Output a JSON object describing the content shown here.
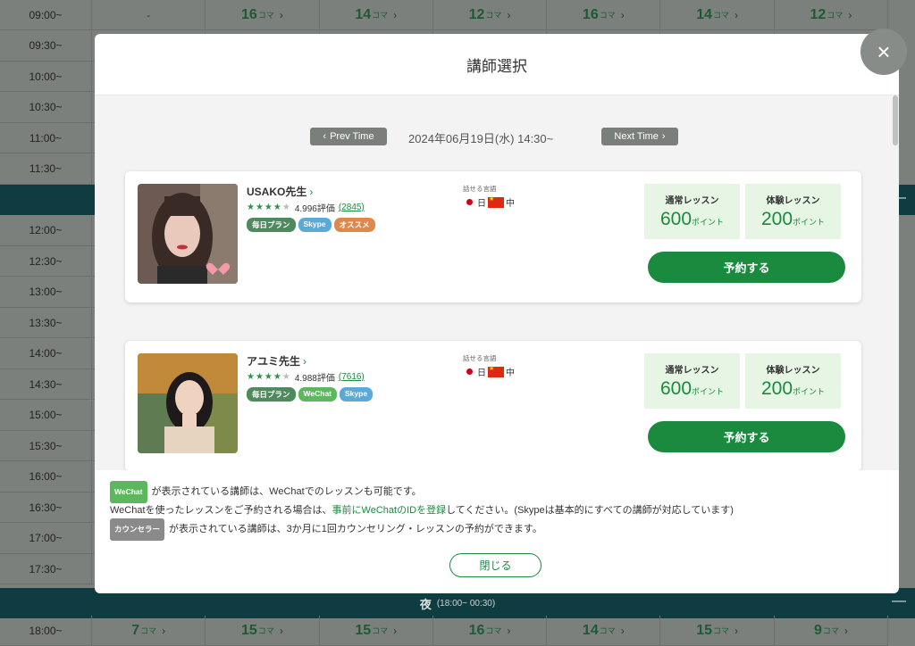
{
  "schedule": {
    "rows": [
      {
        "time": "09:00~",
        "slots": [
          {
            "count": "-"
          },
          {
            "count": "16"
          },
          {
            "count": "14"
          },
          {
            "count": "12"
          },
          {
            "count": "16"
          },
          {
            "count": "14"
          },
          {
            "count": "12"
          }
        ]
      },
      {
        "time": "09:30~"
      },
      {
        "time": "10:00~"
      },
      {
        "time": "10:30~"
      },
      {
        "time": "11:00~"
      },
      {
        "time": "11:30~"
      },
      {
        "band": true
      },
      {
        "time": "12:00~"
      },
      {
        "time": "12:30~"
      },
      {
        "time": "13:00~"
      },
      {
        "time": "13:30~"
      },
      {
        "time": "14:00~"
      },
      {
        "time": "14:30~"
      },
      {
        "time": "15:00~"
      },
      {
        "time": "15:30~"
      },
      {
        "time": "16:00~"
      },
      {
        "time": "16:30~"
      },
      {
        "time": "17:00~"
      },
      {
        "time": "17:30~"
      }
    ],
    "unit": "コマ",
    "band_toggle": "—",
    "evening_band": {
      "title": "夜",
      "sub": "(18:00~ 00:30)",
      "toggle": "—"
    },
    "evening_row": {
      "time": "18:00~",
      "slots": [
        {
          "count": "7"
        },
        {
          "count": "15"
        },
        {
          "count": "15"
        },
        {
          "count": "16"
        },
        {
          "count": "14"
        },
        {
          "count": "15"
        },
        {
          "count": "9"
        }
      ]
    }
  },
  "modal": {
    "title": "講師選択",
    "close_icon": "×",
    "nav": {
      "prev": "Prev Time",
      "next": "Next Time",
      "current": "2024年06月19日(水) 14:30~"
    },
    "lang_label": "話せる言語",
    "lang_jp": "日",
    "lang_cn": "中",
    "teachers": [
      {
        "name": "USAKO先生",
        "rating": "4.996評価",
        "reviews": "(2845)",
        "stars_on": 4,
        "tags": [
          {
            "label": "毎日プラン",
            "color": "#4e8a5d"
          },
          {
            "label": "Skype",
            "color": "#5aa9d6"
          },
          {
            "label": "オススメ",
            "color": "#e0874a"
          }
        ],
        "regular_label": "通常レッスン",
        "regular_points": "600",
        "trial_label": "体験レッスン",
        "trial_points": "200",
        "point_unit": "ポイント",
        "reserve": "予約する"
      },
      {
        "name": "アユミ先生",
        "rating": "4.988評価",
        "reviews": "(7616)",
        "stars_on": 4,
        "tags": [
          {
            "label": "毎日プラン",
            "color": "#4e8a5d"
          },
          {
            "label": "WeChat",
            "color": "#5cb85c"
          },
          {
            "label": "Skype",
            "color": "#5aa9d6"
          }
        ],
        "regular_label": "通常レッスン",
        "regular_points": "600",
        "trial_label": "体験レッスン",
        "trial_points": "200",
        "point_unit": "ポイント",
        "reserve": "予約する"
      }
    ],
    "notes": {
      "wechat_badge": "WeChat",
      "line1": "が表示されている講師は、WeChatでのレッスンも可能です。",
      "line2_pre": "WeChatを使ったレッスンをご予約される場合は、",
      "line2_link": "事前にWeChatのIDを登録",
      "line2_post": "してください。(Skypeは基本的にすべての講師が対応しています)",
      "counselor_badge": "カウンセラー",
      "line3": "が表示されている講師は、3か月に1回カウンセリング・レッスンの予約ができます。"
    },
    "close_button": "閉じる"
  },
  "colors": {
    "accent": "#1a8a3f",
    "overlay": "#7b807c",
    "band": "#0f3c40",
    "price_bg": "#e6f5e4"
  }
}
